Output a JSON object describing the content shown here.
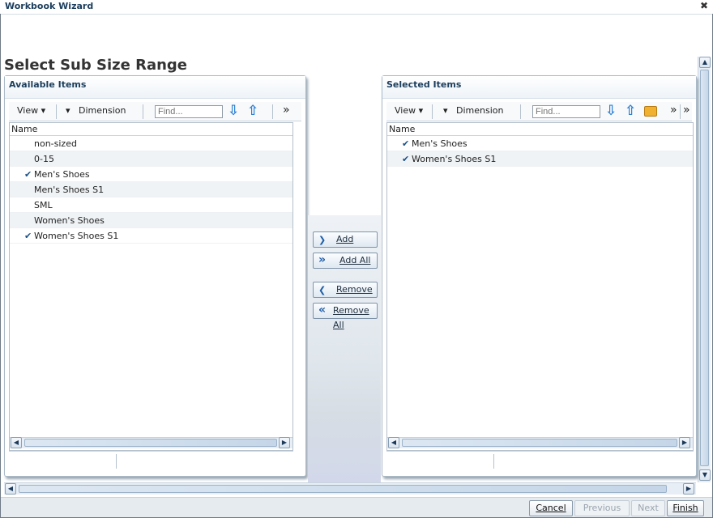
{
  "window": {
    "title": "Workbook Wizard"
  },
  "page": {
    "title": "Select Sub Size Range"
  },
  "available": {
    "title": "Available Items",
    "toolbar": {
      "view": "View ▾",
      "dimension": "Dimension",
      "find_placeholder": "Find..."
    },
    "column": "Name",
    "items": [
      {
        "label": "non-sized",
        "checked": false
      },
      {
        "label": "0-15",
        "checked": false
      },
      {
        "label": "Men's Shoes",
        "checked": true
      },
      {
        "label": "Men's Shoes S1",
        "checked": false
      },
      {
        "label": "SML",
        "checked": false
      },
      {
        "label": "Women's Shoes",
        "checked": false
      },
      {
        "label": "Women's Shoes S1",
        "checked": true
      }
    ]
  },
  "selected": {
    "title": "Selected Items",
    "toolbar": {
      "view": "View ▾",
      "dimension": "Dimension",
      "find_placeholder": "Find..."
    },
    "column": "Name",
    "items": [
      {
        "label": "Men's Shoes",
        "checked": true
      },
      {
        "label": "Women's Shoes S1",
        "checked": true
      }
    ]
  },
  "shuttle": {
    "add": "Add",
    "add_all": "Add All",
    "remove": "Remove",
    "remove_all": "Remove All"
  },
  "footer": {
    "cancel": "Cancel",
    "previous": "Previous",
    "next": "Next",
    "finish": "Finish"
  },
  "icons": {
    "down_arrow": "⇩",
    "up_arrow": "⇧",
    "more": "»",
    "check": "✔",
    "close": "✖",
    "add": "❯",
    "add_all": "»",
    "remove": "❮",
    "remove_all": "«"
  },
  "colors": {
    "accent": "#1b3d5c",
    "arrow": "#2a7fd4"
  }
}
